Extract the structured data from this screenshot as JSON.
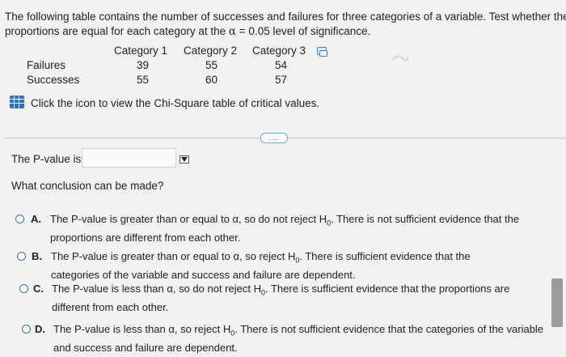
{
  "intro": {
    "line1": "The following table contains the number of successes and failures for three categories of a variable. Test whether the",
    "line2_pre": "proportions are equal for each category at the ",
    "alpha_symbol": "α",
    "line2_post": " = 0.05 level of significance."
  },
  "table": {
    "headers": [
      "Category 1",
      "Category 2",
      "Category 3"
    ],
    "rows": [
      {
        "label": "Failures",
        "values": [
          "39",
          "55",
          "54"
        ]
      },
      {
        "label": "Successes",
        "values": [
          "55",
          "60",
          "57"
        ]
      }
    ]
  },
  "chi_square_link": "Click the icon to view the Chi-Square table of critical values.",
  "more_button": "....",
  "pvalue": {
    "label": "The P-value is",
    "value": ""
  },
  "question": "What conclusion can be made?",
  "options": [
    {
      "letter": "A.",
      "line1": "The P-value is greater than or equal to α, so do not reject H",
      "sub": "0",
      "line1_post": ". There is not sufficient evidence that the",
      "line2": "proportions are different from each other."
    },
    {
      "letter": "B.",
      "line1": "The P-value is greater than or equal to α, so reject H",
      "sub": "0",
      "line1_post": ". There is sufficient evidence that the",
      "line2": "categories of the variable and success and failure are dependent."
    },
    {
      "letter": "C.",
      "line1": "The P-value is less than α, so do not reject H",
      "sub": "0",
      "line1_post": ". There is sufficient evidence that the proportions are",
      "line2": "different from each other."
    },
    {
      "letter": "D.",
      "line1": "The P-value is less than α, so reject H",
      "sub": "0",
      "line1_post": ". There is not sufficient evidence that the categories of the variable",
      "line2": "and success and failure are dependent."
    }
  ],
  "colors": {
    "accent": "#2f6fc9",
    "background": "#f2f2f0"
  }
}
